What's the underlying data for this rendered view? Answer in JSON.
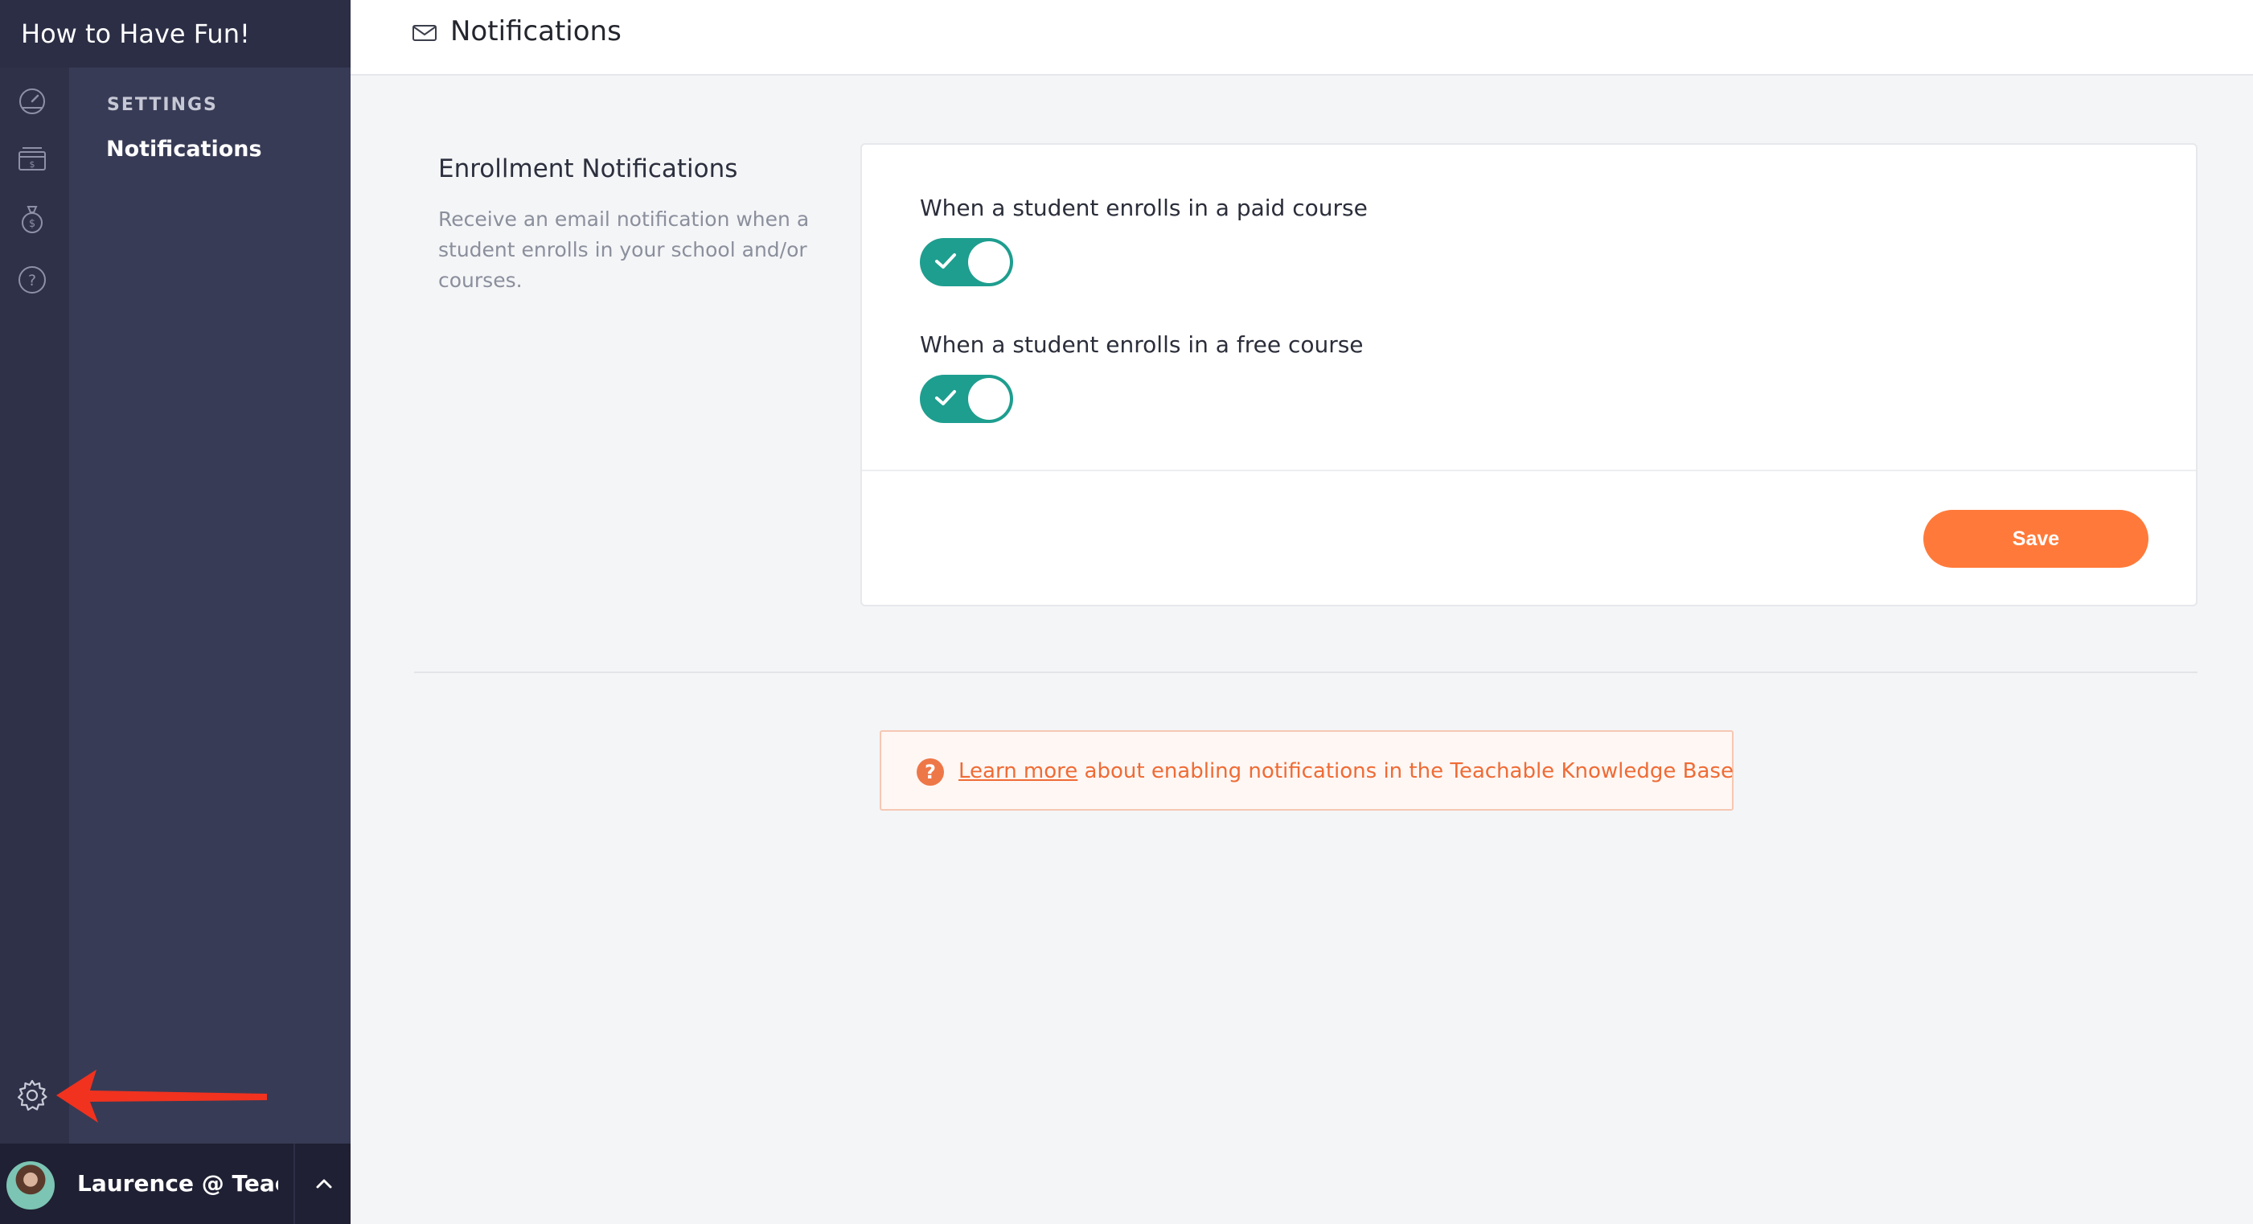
{
  "school": {
    "name": "How to Have Fun!"
  },
  "rail": {
    "icons": [
      "dashboard-gauge-icon",
      "sales-register-icon",
      "money-bag-icon",
      "help-circle-icon"
    ],
    "bottom_icon": "gear-icon"
  },
  "settings_nav": {
    "heading": "SETTINGS",
    "items": [
      {
        "label": "Notifications",
        "active": true
      }
    ]
  },
  "user": {
    "name": "Laurence @ Teac..."
  },
  "header": {
    "icon": "mail-icon",
    "title": "Notifications"
  },
  "section": {
    "title": "Enrollment Notifications",
    "description": "Receive an email notification when a student enrolls in your school and/or courses."
  },
  "toggles": [
    {
      "label": "When a student enrolls in a paid course",
      "on": true
    },
    {
      "label": "When a student enrolls in a free course",
      "on": true
    }
  ],
  "actions": {
    "save_label": "Save"
  },
  "help": {
    "link_text": "Learn more",
    "rest_text": " about enabling notifications in the Teachable Knowledge Base",
    "icon": "?"
  },
  "colors": {
    "sidebar": "#383b55",
    "rail": "#2f3149",
    "toggle_on": "#1e9e8f",
    "save_button": "#ff7a3a",
    "help_text": "#ef6b35",
    "annotation_arrow": "#f0321f"
  }
}
